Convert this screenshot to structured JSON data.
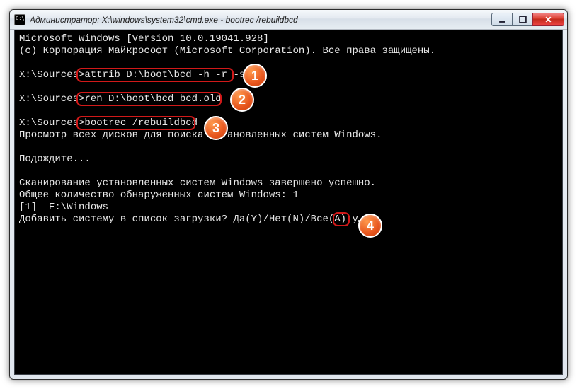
{
  "window": {
    "title": "Администратор: X:\\windows\\system32\\cmd.exe - bootrec  /rebuildbcd"
  },
  "terminal": {
    "line1": "Microsoft Windows [Version 10.0.19041.928]",
    "line2": "(c) Корпорация Майкрософт (Microsoft Corporation). Все права защищены.",
    "prompt1": "X:\\Sources>",
    "cmd1": "attrib D:\\boot\\bcd -h -r -s",
    "prompt2": "X:\\Sources>",
    "cmd2": "ren D:\\boot\\bcd bcd.old",
    "prompt3": "X:\\Sources>",
    "cmd3": "bootrec /rebuildbcd",
    "scan_msg": "Просмотр всех дисков для поиска установленных систем Windows.",
    "wait_msg": "Подождите...",
    "done_msg": "Сканирование установленных систем Windows завершено успешно.",
    "count_msg": "Общее количество обнаруженных систем Windows: 1",
    "found_msg": "[1]  E:\\Windows",
    "add_prompt": "Добавить систему в список загрузки? Да(Y)/Нет(N)/Все(A):",
    "user_input": "y"
  },
  "badges": {
    "b1": "1",
    "b2": "2",
    "b3": "3",
    "b4": "4"
  }
}
